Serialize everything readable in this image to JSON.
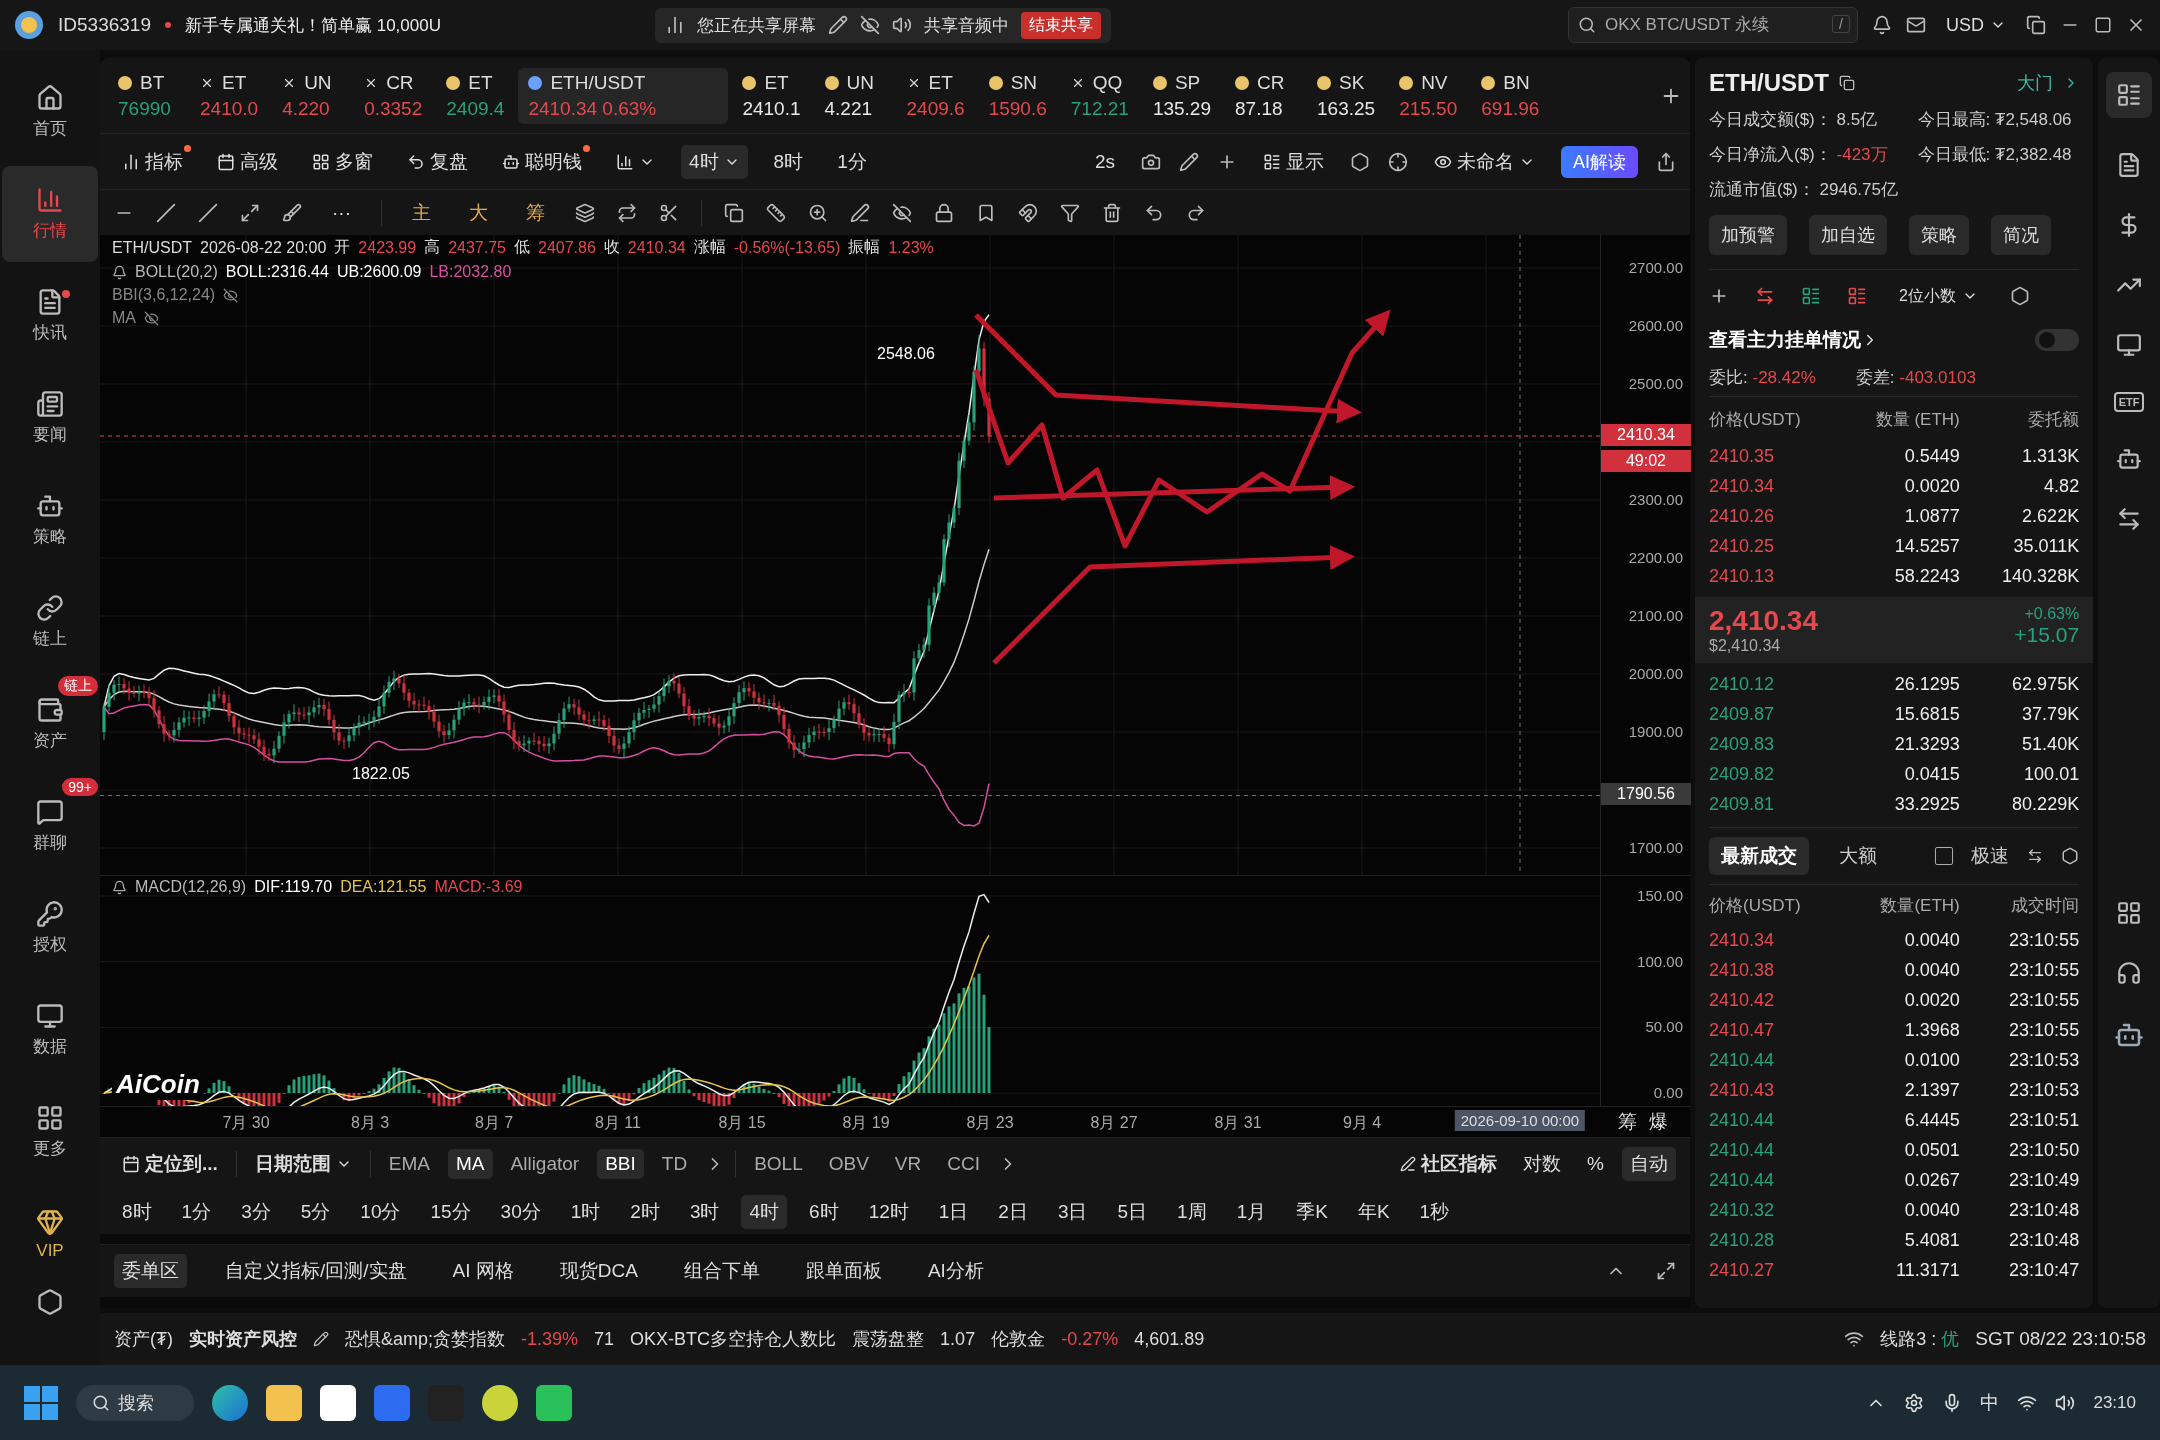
{
  "title_bar": {
    "account_id": "ID5336319",
    "promo": "新手专属通关礼！简单赢 10,000U",
    "share_status": "您正在共享屏幕",
    "audio_status": "共享音频中",
    "end_share": "结束共享",
    "search": {
      "placeholder": "OKX BTC/USDT 永续",
      "shortcut": "/"
    },
    "currency": "USD"
  },
  "sidebar": {
    "items": [
      {
        "label": "首页",
        "selected": false,
        "dot": false
      },
      {
        "label": "行情",
        "selected": true,
        "dot": false
      },
      {
        "label": "快讯",
        "selected": false,
        "dot": true
      },
      {
        "label": "要闻",
        "selected": false,
        "dot": false
      },
      {
        "label": "策略",
        "selected": false,
        "dot": false
      },
      {
        "label": "链上",
        "selected": false,
        "dot": false
      },
      {
        "label": "资产",
        "selected": false,
        "dot": false,
        "badge": "链上"
      },
      {
        "label": "群聊",
        "selected": false,
        "dot": false,
        "badge": "99+"
      },
      {
        "label": "授权",
        "selected": false,
        "dot": false
      },
      {
        "label": "数据",
        "selected": false,
        "dot": false
      },
      {
        "label": "更多",
        "selected": false,
        "dot": false
      },
      {
        "label": "VIP",
        "selected": false,
        "dot": false
      }
    ]
  },
  "tickers": [
    {
      "symbol": "BT",
      "price": "76990",
      "color": "#26a17b",
      "kind": "coin",
      "selected": false
    },
    {
      "symbol": "ET",
      "price": "2410.0",
      "color": "#e5484d",
      "kind": "cross",
      "selected": false
    },
    {
      "symbol": "UN",
      "price": "4.220",
      "color": "#e5484d",
      "kind": "cross",
      "selected": false
    },
    {
      "symbol": "CR",
      "price": "0.3352",
      "color": "#e5484d",
      "kind": "cross",
      "selected": false
    },
    {
      "symbol": "ET",
      "price": "2409.4",
      "color": "#26a17b",
      "kind": "coin",
      "selected": false
    },
    {
      "symbol": "ETH/USDT",
      "price": "2410.34",
      "change": "0.63%",
      "color": "#e5484d",
      "kind": "coin",
      "selected": true
    },
    {
      "symbol": "ET",
      "price": "2410.1",
      "color": "#e8e8e8",
      "kind": "coin",
      "selected": false
    },
    {
      "symbol": "UN",
      "price": "4.221",
      "color": "#e8e8e8",
      "kind": "coin",
      "selected": false
    },
    {
      "symbol": "ET",
      "price": "2409.6",
      "color": "#e5484d",
      "kind": "cross",
      "selected": false
    },
    {
      "symbol": "SN",
      "price": "1590.6",
      "color": "#e5484d",
      "kind": "coin",
      "selected": false
    },
    {
      "symbol": "QQ",
      "price": "712.21",
      "color": "#26a17b",
      "kind": "cross",
      "selected": false
    },
    {
      "symbol": "SP",
      "price": "135.29",
      "color": "#e8e8e8",
      "kind": "coin",
      "selected": false
    },
    {
      "symbol": "CR",
      "price": "87.18",
      "color": "#e8e8e8",
      "kind": "coin",
      "selected": false
    },
    {
      "symbol": "SK",
      "price": "163.25",
      "color": "#e8e8e8",
      "kind": "coin",
      "selected": false
    },
    {
      "symbol": "NV",
      "price": "215.50",
      "color": "#e5484d",
      "kind": "coin",
      "selected": false
    },
    {
      "symbol": "BN",
      "price": "691.96",
      "color": "#e5484d",
      "kind": "coin",
      "selected": false
    }
  ],
  "toolbar": {
    "items": [
      {
        "label": "指标",
        "dot": true
      },
      {
        "label": "高级",
        "dot": false
      },
      {
        "label": "多窗",
        "dot": false
      },
      {
        "label": "复盘",
        "dot": false
      },
      {
        "label": "聪明钱",
        "dot": true
      }
    ],
    "periods": [
      {
        "label": "4时",
        "selected": true
      },
      {
        "label": "8时",
        "selected": false
      },
      {
        "label": "1分",
        "selected": false
      }
    ],
    "refresh": "2s",
    "display": "显示",
    "layout_name": "未命名",
    "ai_button": "AI解读"
  },
  "draw_tools": {
    "more": "···",
    "text_tools": [
      "主",
      "大",
      "筹"
    ]
  },
  "chart": {
    "header": {
      "symbol": "ETH/USDT",
      "time": "2026-08-22 20:00",
      "fields": [
        {
          "label": "开",
          "value": "2423.99"
        },
        {
          "label": "高",
          "value": "2437.75"
        },
        {
          "label": "低",
          "value": "2407.86"
        },
        {
          "label": "收",
          "value": "2410.34"
        },
        {
          "label": "涨幅",
          "value": "-0.56%(-13.65)"
        },
        {
          "label": "振幅",
          "value": "1.23%"
        }
      ]
    },
    "boll": {
      "name": "BOLL(20,2)",
      "mid": "BOLL:2316.44",
      "upper": "UB:2600.09",
      "lower": "LB:2032.80"
    },
    "bbi": "BBI(3,6,12,24)",
    "ma": "MA",
    "macd": {
      "name": "MACD(12,26,9)",
      "dif": "DIF:119.70",
      "dea": "DEA:121.55",
      "hist": "MACD:-3.69"
    },
    "high_label": "2548.06",
    "low_label": "1822.05",
    "price_ticks": [
      "2700.00",
      "2600.00",
      "2500.00",
      "2300.00",
      "2200.00",
      "2100.00",
      "2000.00",
      "1900.00",
      "1700.00"
    ],
    "last_price_tag": "2410.34",
    "countdown": "49:02",
    "cursor_price": "1790.56",
    "macd_ticks": [
      "150.00",
      "100.00",
      "50.00",
      "0.00"
    ],
    "date_ticks": [
      "7月 30",
      "8月 3",
      "8月 7",
      "8月 11",
      "8月 15",
      "8月 19",
      "8月 23",
      "8月 27",
      "8月 31",
      "9月 4"
    ],
    "cursor_date": "2026-09-10 00:00",
    "axis_buttons": [
      "筹",
      "爆"
    ],
    "logo": "AiCoin"
  },
  "indicator_bar": {
    "locate": "定位到...",
    "date_range": "日期范围",
    "main_indicators": [
      {
        "label": "EMA",
        "selected": false
      },
      {
        "label": "MA",
        "selected": true
      },
      {
        "label": "Alligator",
        "selected": false
      },
      {
        "label": "BBI",
        "selected": true
      },
      {
        "label": "TD",
        "selected": false
      }
    ],
    "sub_indicators": [
      {
        "label": "BOLL",
        "selected": false
      },
      {
        "label": "OBV",
        "selected": false
      },
      {
        "label": "VR",
        "selected": false
      },
      {
        "label": "CCI",
        "selected": false
      }
    ],
    "community": "社区指标",
    "scale_options": [
      {
        "label": "对数",
        "selected": false
      },
      {
        "label": "%",
        "selected": false
      },
      {
        "label": "自动",
        "selected": true
      }
    ]
  },
  "timeframes": [
    {
      "label": "8时",
      "selected": false
    },
    {
      "label": "1分",
      "selected": false
    },
    {
      "label": "3分",
      "selected": false
    },
    {
      "label": "5分",
      "selected": false
    },
    {
      "label": "10分",
      "selected": false
    },
    {
      "label": "15分",
      "selected": false
    },
    {
      "label": "30分",
      "selected": false
    },
    {
      "label": "1时",
      "selected": false
    },
    {
      "label": "2时",
      "selected": false
    },
    {
      "label": "3时",
      "selected": false
    },
    {
      "label": "4时",
      "selected": true
    },
    {
      "label": "6时",
      "selected": false
    },
    {
      "label": "12时",
      "selected": false
    },
    {
      "label": "1日",
      "selected": false
    },
    {
      "label": "2日",
      "selected": false
    },
    {
      "label": "3日",
      "selected": false
    },
    {
      "label": "5日",
      "selected": false
    },
    {
      "label": "1周",
      "selected": false
    },
    {
      "label": "1月",
      "selected": false
    },
    {
      "label": "季K",
      "selected": false
    },
    {
      "label": "年K",
      "selected": false
    },
    {
      "label": "1秒",
      "selected": false
    }
  ],
  "bottom_tabs": [
    {
      "label": "委单区",
      "selected": true
    },
    {
      "label": "自定义指标/回测/实盘",
      "selected": false
    },
    {
      "label": "AI 网格",
      "selected": false
    },
    {
      "label": "现货DCA",
      "selected": false
    },
    {
      "label": "组合下单",
      "selected": false
    },
    {
      "label": "跟单面板",
      "selected": false
    },
    {
      "label": "AI分析",
      "selected": false
    }
  ],
  "status_bar": {
    "assets": "资产(₮)",
    "risk": "实时资产风控",
    "feeds": [
      {
        "name": "恐惧&amp;贪婪指数",
        "change": "-1.39%",
        "value": "71"
      },
      {
        "name": "OKX-BTC多空持仓人数比",
        "status": "震荡盘整",
        "value": "1.07"
      },
      {
        "name": "伦敦金",
        "change": "-0.27%",
        "value": "4,601.89"
      }
    ],
    "line": "线路3 :",
    "line_quality": "优",
    "clock": "SGT 08/22 23:10:58"
  },
  "right_panel": {
    "symbol": "ETH/USDT",
    "gate": "大门",
    "stats": [
      {
        "label": "今日成交额($)：",
        "value": "8.5亿",
        "color": "#cccccc"
      },
      {
        "label": "今日最高:",
        "value": "₮2,548.06",
        "color": "#cccccc"
      },
      {
        "label": "今日净流入($)：",
        "value": "-423万",
        "color": "#e5484d"
      },
      {
        "label": "今日最低:",
        "value": "₮2,382.48",
        "color": "#cccccc"
      },
      {
        "label": "流通市值($)：",
        "value": "2946.75亿",
        "color": "#cccccc"
      }
    ],
    "actions": [
      "加预警",
      "加自选",
      "策略",
      "简况"
    ],
    "depth_precision": "2位小数",
    "view_toggle": {
      "label": "查看主力挂单情况",
      "on": false
    },
    "ratio": {
      "label": "委比:",
      "value": "-28.42%"
    },
    "diff": {
      "label": "委差:",
      "value": "-403.0103"
    },
    "book_columns": [
      "价格(USDT)",
      "数量 (ETH)",
      "委托额"
    ],
    "asks": [
      {
        "price": "2410.35",
        "amount": "0.5449",
        "total": "1.313K"
      },
      {
        "price": "2410.34",
        "amount": "0.0020",
        "total": "4.82"
      },
      {
        "price": "2410.26",
        "amount": "1.0877",
        "total": "2.622K"
      },
      {
        "price": "2410.25",
        "amount": "14.5257",
        "total": "35.011K"
      },
      {
        "price": "2410.13",
        "amount": "58.2243",
        "total": "140.328K"
      }
    ],
    "last": {
      "price": "2,410.34",
      "usd": "$2,410.34",
      "change_pct": "+0.63%",
      "change": "+15.07"
    },
    "bids": [
      {
        "price": "2410.12",
        "amount": "26.1295",
        "total": "62.975K"
      },
      {
        "price": "2409.87",
        "amount": "15.6815",
        "total": "37.79K"
      },
      {
        "price": "2409.83",
        "amount": "21.3293",
        "total": "51.40K"
      },
      {
        "price": "2409.82",
        "amount": "0.0415",
        "total": "100.01"
      },
      {
        "price": "2409.81",
        "amount": "33.2925",
        "total": "80.229K"
      }
    ],
    "trade_tabs": [
      {
        "label": "最新成交",
        "selected": true
      },
      {
        "label": "大额",
        "selected": false
      }
    ],
    "fast_mode": {
      "label": "极速",
      "checked": false
    },
    "trade_columns": [
      "价格(USDT)",
      "数量(ETH)",
      "成交时间"
    ],
    "trades": [
      {
        "price": "2410.34",
        "amount": "0.0040",
        "time": "23:10:55",
        "color": "#e5484d"
      },
      {
        "price": "2410.38",
        "amount": "0.0040",
        "time": "23:10:55",
        "color": "#e5484d"
      },
      {
        "price": "2410.42",
        "amount": "0.0020",
        "time": "23:10:55",
        "color": "#e5484d"
      },
      {
        "price": "2410.47",
        "amount": "1.3968",
        "time": "23:10:55",
        "color": "#e5484d"
      },
      {
        "price": "2410.44",
        "amount": "0.0100",
        "time": "23:10:53",
        "color": "#26a17b"
      },
      {
        "price": "2410.43",
        "amount": "2.1397",
        "time": "23:10:53",
        "color": "#e5484d"
      },
      {
        "price": "2410.44",
        "amount": "6.4445",
        "time": "23:10:51",
        "color": "#26a17b"
      },
      {
        "price": "2410.44",
        "amount": "0.0501",
        "time": "23:10:50",
        "color": "#26a17b"
      },
      {
        "price": "2410.44",
        "amount": "0.0267",
        "time": "23:10:49",
        "color": "#26a17b"
      },
      {
        "price": "2410.32",
        "amount": "0.0040",
        "time": "23:10:48",
        "color": "#26a17b"
      },
      {
        "price": "2410.28",
        "amount": "5.4081",
        "time": "23:10:48",
        "color": "#26a17b"
      },
      {
        "price": "2410.27",
        "amount": "11.3171",
        "time": "23:10:47",
        "color": "#e5484d"
      }
    ]
  },
  "right_rail": {
    "etf_label": "ETF"
  },
  "taskbar": {
    "search": "搜索",
    "ime": "中",
    "time": "23:10"
  }
}
